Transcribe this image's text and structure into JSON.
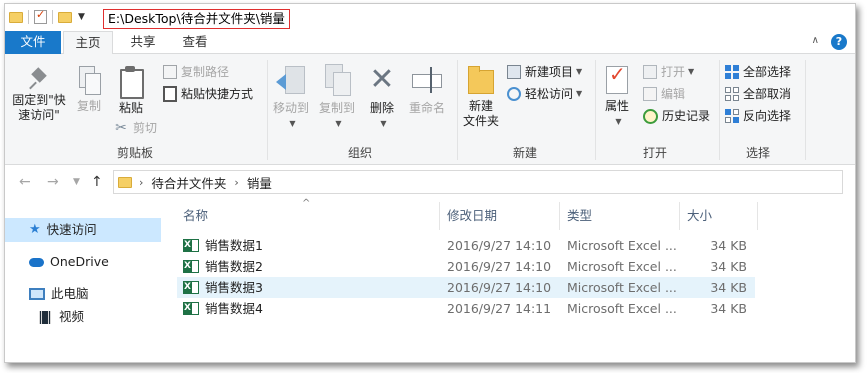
{
  "title_bar": {
    "path": "E:\\DeskTop\\待合并文件夹\\销量"
  },
  "tabs": {
    "file": "文件",
    "home": "主页",
    "share": "共享",
    "view": "查看"
  },
  "ribbon": {
    "clipboard": {
      "label": "剪贴板",
      "pin": "固定到\"快\n速访问\"",
      "copy": "复制",
      "paste": "粘贴",
      "copy_path": "复制路径",
      "paste_shortcut": "粘贴快捷方式",
      "cut": "剪切"
    },
    "organize": {
      "label": "组织",
      "move_to": "移动到",
      "copy_to": "复制到",
      "delete": "删除",
      "rename": "重命名"
    },
    "new": {
      "label": "新建",
      "new_folder_line1": "新建",
      "new_folder_line2": "文件夹",
      "new_item": "新建项目",
      "easy_access": "轻松访问"
    },
    "open": {
      "label": "打开",
      "properties": "属性",
      "open": "打开",
      "edit": "编辑",
      "history": "历史记录"
    },
    "select": {
      "label": "选择",
      "select_all": "全部选择",
      "select_none": "全部取消",
      "invert": "反向选择"
    }
  },
  "address": {
    "crumbs": [
      "待合并文件夹",
      "销量"
    ]
  },
  "nav_pane": {
    "quick_access": "快速访问",
    "onedrive": "OneDrive",
    "this_pc": "此电脑",
    "videos": "视频"
  },
  "columns": {
    "name": "名称",
    "modified": "修改日期",
    "type": "类型",
    "size": "大小"
  },
  "files": [
    {
      "name": "销售数据1",
      "modified": "2016/9/27 14:10",
      "type": "Microsoft Excel ...",
      "size": "34 KB"
    },
    {
      "name": "销售数据2",
      "modified": "2016/9/27 14:10",
      "type": "Microsoft Excel ...",
      "size": "34 KB"
    },
    {
      "name": "销售数据3",
      "modified": "2016/9/27 14:10",
      "type": "Microsoft Excel ...",
      "size": "34 KB"
    },
    {
      "name": "销售数据4",
      "modified": "2016/9/27 14:11",
      "type": "Microsoft Excel ...",
      "size": "34 KB"
    }
  ],
  "selected_row_index": 2
}
